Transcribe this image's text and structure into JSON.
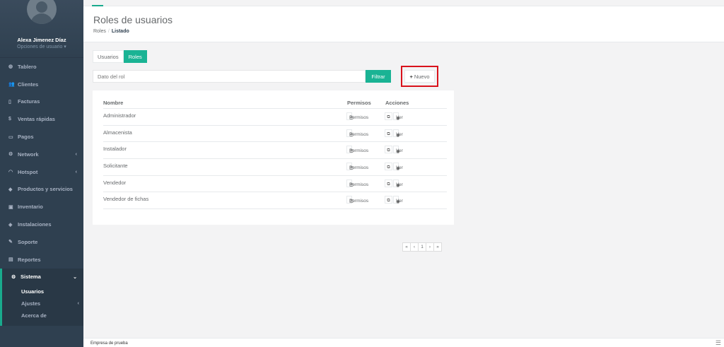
{
  "sidebar": {
    "user_name": "Alexa Jimenez Díaz",
    "user_options": "Opciones de usuario ▾",
    "items": [
      {
        "label": "Tablero",
        "icon": "dashboard-icon",
        "glyph": "◍"
      },
      {
        "label": "Clientes",
        "icon": "users-icon",
        "glyph": "👥"
      },
      {
        "label": "Facturas",
        "icon": "file-icon",
        "glyph": "▯"
      },
      {
        "label": "Ventas rápidas",
        "icon": "dollar-icon",
        "glyph": "$"
      },
      {
        "label": "Pagos",
        "icon": "money-icon",
        "glyph": "▭"
      },
      {
        "label": "Network",
        "icon": "sitemap-icon",
        "glyph": "⚙",
        "chevron": "‹"
      },
      {
        "label": "Hotspot",
        "icon": "wifi-icon",
        "glyph": "◠",
        "chevron": "‹"
      },
      {
        "label": "Productos y servicios",
        "icon": "tags-icon",
        "glyph": "◆"
      },
      {
        "label": "Inventario",
        "icon": "cubes-icon",
        "glyph": "▣"
      },
      {
        "label": "Instalaciones",
        "icon": "tools-icon",
        "glyph": "◈"
      },
      {
        "label": "Soporte",
        "icon": "wrench-icon",
        "glyph": "✎"
      },
      {
        "label": "Reportes",
        "icon": "book-icon",
        "glyph": "▤"
      }
    ],
    "active_item": {
      "label": "Sistema",
      "icon": "cogs-icon",
      "glyph": "⚙",
      "chevron": "⌄"
    },
    "sub_items": [
      {
        "label": "Usuarios"
      },
      {
        "label": "Ajustes",
        "chevron": "‹"
      },
      {
        "label": "Acerca de"
      }
    ]
  },
  "header": {
    "title": "Roles de usuarios",
    "breadcrumb_root": "Roles",
    "breadcrumb_sep": "/",
    "breadcrumb_current": "Listado"
  },
  "tabs": [
    {
      "label": "Usuarios",
      "active": false
    },
    {
      "label": "Roles",
      "active": true
    }
  ],
  "filter": {
    "placeholder": "Dato del rol",
    "button_label": "Filtrar"
  },
  "new_button": {
    "plus": "+",
    "label": "Nuevo"
  },
  "table": {
    "headers": [
      "Nombre",
      "Permisos",
      "Acciones"
    ],
    "permisos_label": "Permisos",
    "ver_label": "Ver",
    "rows": [
      {
        "name": "Administrador"
      },
      {
        "name": "Almacenista"
      },
      {
        "name": "Instalador"
      },
      {
        "name": "Solicitante"
      },
      {
        "name": "Vendedor"
      },
      {
        "name": "Vendedor de fichas"
      }
    ]
  },
  "pagination": {
    "first": "«",
    "prev": "‹",
    "page": "1",
    "next": "›",
    "last": "»"
  },
  "footer": {
    "company": "Empresa de prueba"
  },
  "colors": {
    "accent": "#1ab394",
    "sidebar": "#2f4050",
    "highlight_frame": "#d9121b"
  }
}
